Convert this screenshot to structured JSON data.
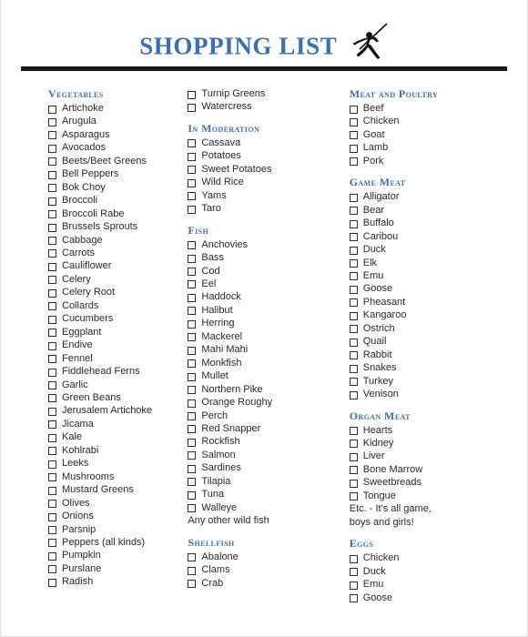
{
  "document": {
    "title": "SHOPPING LIST",
    "title_color": "#3a6fb8",
    "heading_color": "#3a6fb8",
    "text_color": "#262a33",
    "rule_color": "#1a1a1a",
    "icon": "javelin-thrower-icon"
  },
  "columns": [
    {
      "id": "column-1",
      "sections": [
        {
          "heading": "Vegetables",
          "items": [
            {
              "label": "Artichoke",
              "checkbox": true
            },
            {
              "label": "Arugula",
              "checkbox": true
            },
            {
              "label": "Asparagus",
              "checkbox": true
            },
            {
              "label": "Avocados",
              "checkbox": true
            },
            {
              "label": "Beets/Beet Greens",
              "checkbox": true
            },
            {
              "label": "Bell Peppers",
              "checkbox": true
            },
            {
              "label": "Bok Choy",
              "checkbox": true
            },
            {
              "label": "Broccoli",
              "checkbox": true
            },
            {
              "label": "Broccoli Rabe",
              "checkbox": true
            },
            {
              "label": "Brussels Sprouts",
              "checkbox": true
            },
            {
              "label": "Cabbage",
              "checkbox": true
            },
            {
              "label": "Carrots",
              "checkbox": true
            },
            {
              "label": "Cauliflower",
              "checkbox": true
            },
            {
              "label": "Celery",
              "checkbox": true
            },
            {
              "label": "Celery Root",
              "checkbox": true
            },
            {
              "label": "Collards",
              "checkbox": true
            },
            {
              "label": "Cucumbers",
              "checkbox": true
            },
            {
              "label": "Eggplant",
              "checkbox": true
            },
            {
              "label": "Endive",
              "checkbox": true
            },
            {
              "label": "Fennel",
              "checkbox": true
            },
            {
              "label": "Fiddlehead Ferns",
              "checkbox": true
            },
            {
              "label": "Garlic",
              "checkbox": true
            },
            {
              "label": "Green Beans",
              "checkbox": true
            },
            {
              "label": "Jerusalem Artichoke",
              "checkbox": true
            },
            {
              "label": "Jicama",
              "checkbox": true
            },
            {
              "label": "Kale",
              "checkbox": true
            },
            {
              "label": "Kohlrabi",
              "checkbox": true
            },
            {
              "label": "Leeks",
              "checkbox": true
            },
            {
              "label": "Mushrooms",
              "checkbox": true
            },
            {
              "label": "Mustard Greens",
              "checkbox": true
            },
            {
              "label": "Olives",
              "checkbox": true
            },
            {
              "label": "Onions",
              "checkbox": true
            },
            {
              "label": "Parsnip",
              "checkbox": true
            },
            {
              "label": "Peppers (all kinds)",
              "checkbox": true
            },
            {
              "label": "Pumpkin",
              "checkbox": true
            },
            {
              "label": "Purslane",
              "checkbox": true
            },
            {
              "label": "Radish",
              "checkbox": true
            }
          ]
        }
      ]
    },
    {
      "id": "column-2",
      "sections": [
        {
          "heading": "",
          "items": [
            {
              "label": "Turnip Greens",
              "checkbox": true
            },
            {
              "label": "Watercress",
              "checkbox": true
            }
          ]
        },
        {
          "heading": "In Moderation",
          "items": [
            {
              "label": "Cassava",
              "checkbox": true
            },
            {
              "label": "Potatoes",
              "checkbox": true
            },
            {
              "label": "Sweet Potatoes",
              "checkbox": true
            },
            {
              "label": "Wild Rice",
              "checkbox": true
            },
            {
              "label": "Yams",
              "checkbox": true
            },
            {
              "label": "Taro",
              "checkbox": true
            }
          ]
        },
        {
          "heading": "Fish",
          "items": [
            {
              "label": "Anchovies",
              "checkbox": true
            },
            {
              "label": "Bass",
              "checkbox": true
            },
            {
              "label": "Cod",
              "checkbox": true
            },
            {
              "label": "Eel",
              "checkbox": true
            },
            {
              "label": "Haddock",
              "checkbox": true
            },
            {
              "label": "Halibut",
              "checkbox": true
            },
            {
              "label": "Herring",
              "checkbox": true
            },
            {
              "label": "Mackerel",
              "checkbox": true
            },
            {
              "label": "Mahi Mahi",
              "checkbox": true
            },
            {
              "label": "Monkfish",
              "checkbox": true
            },
            {
              "label": "Mullet",
              "checkbox": true
            },
            {
              "label": "Northern Pike",
              "checkbox": true
            },
            {
              "label": "Orange Roughy",
              "checkbox": true
            },
            {
              "label": "Perch",
              "checkbox": true
            },
            {
              "label": "Red Snapper",
              "checkbox": true
            },
            {
              "label": "Rockfish",
              "checkbox": true
            },
            {
              "label": "Salmon",
              "checkbox": true
            },
            {
              "label": "Sardines",
              "checkbox": true
            },
            {
              "label": "Tilapia",
              "checkbox": true
            },
            {
              "label": "Tuna",
              "checkbox": true
            },
            {
              "label": "Walleye",
              "checkbox": true
            },
            {
              "label": "Any other wild fish",
              "checkbox": false
            }
          ]
        },
        {
          "heading": "Shellfish",
          "items": [
            {
              "label": "Abalone",
              "checkbox": true
            },
            {
              "label": "Clams",
              "checkbox": true
            },
            {
              "label": "Crab",
              "checkbox": true
            }
          ]
        }
      ]
    },
    {
      "id": "column-3",
      "sections": [
        {
          "heading": "Meat and Poultry",
          "items": [
            {
              "label": "Beef",
              "checkbox": true
            },
            {
              "label": "Chicken",
              "checkbox": true
            },
            {
              "label": "Goat",
              "checkbox": true
            },
            {
              "label": "Lamb",
              "checkbox": true
            },
            {
              "label": "Pork",
              "checkbox": true
            }
          ]
        },
        {
          "heading": "Game Meat",
          "items": [
            {
              "label": "Alligator",
              "checkbox": true
            },
            {
              "label": "Bear",
              "checkbox": true
            },
            {
              "label": "Buffalo",
              "checkbox": true
            },
            {
              "label": "Caribou",
              "checkbox": true
            },
            {
              "label": "Duck",
              "checkbox": true
            },
            {
              "label": "Elk",
              "checkbox": true
            },
            {
              "label": "Emu",
              "checkbox": true
            },
            {
              "label": "Goose",
              "checkbox": true
            },
            {
              "label": "Pheasant",
              "checkbox": true
            },
            {
              "label": "Kangaroo",
              "checkbox": true
            },
            {
              "label": "Ostrich",
              "checkbox": true
            },
            {
              "label": "Quail",
              "checkbox": true
            },
            {
              "label": "Rabbit",
              "checkbox": true
            },
            {
              "label": "Snakes",
              "checkbox": true
            },
            {
              "label": "Turkey",
              "checkbox": true
            },
            {
              "label": "Venison",
              "checkbox": true
            }
          ]
        },
        {
          "heading": "Organ Meat",
          "items": [
            {
              "label": "Hearts",
              "checkbox": true
            },
            {
              "label": "Kidney",
              "checkbox": true
            },
            {
              "label": "Liver",
              "checkbox": true
            },
            {
              "label": "Bone Marrow",
              "checkbox": true
            },
            {
              "label": "Sweetbreads",
              "checkbox": true
            },
            {
              "label": "Tongue",
              "checkbox": true
            },
            {
              "label": "Etc. - It's all game, boys and girls!",
              "checkbox": false
            }
          ]
        },
        {
          "heading": "Eggs",
          "items": [
            {
              "label": "Chicken",
              "checkbox": true
            },
            {
              "label": "Duck",
              "checkbox": true
            },
            {
              "label": "Emu",
              "checkbox": true
            },
            {
              "label": "Goose",
              "checkbox": true
            }
          ]
        }
      ]
    }
  ]
}
